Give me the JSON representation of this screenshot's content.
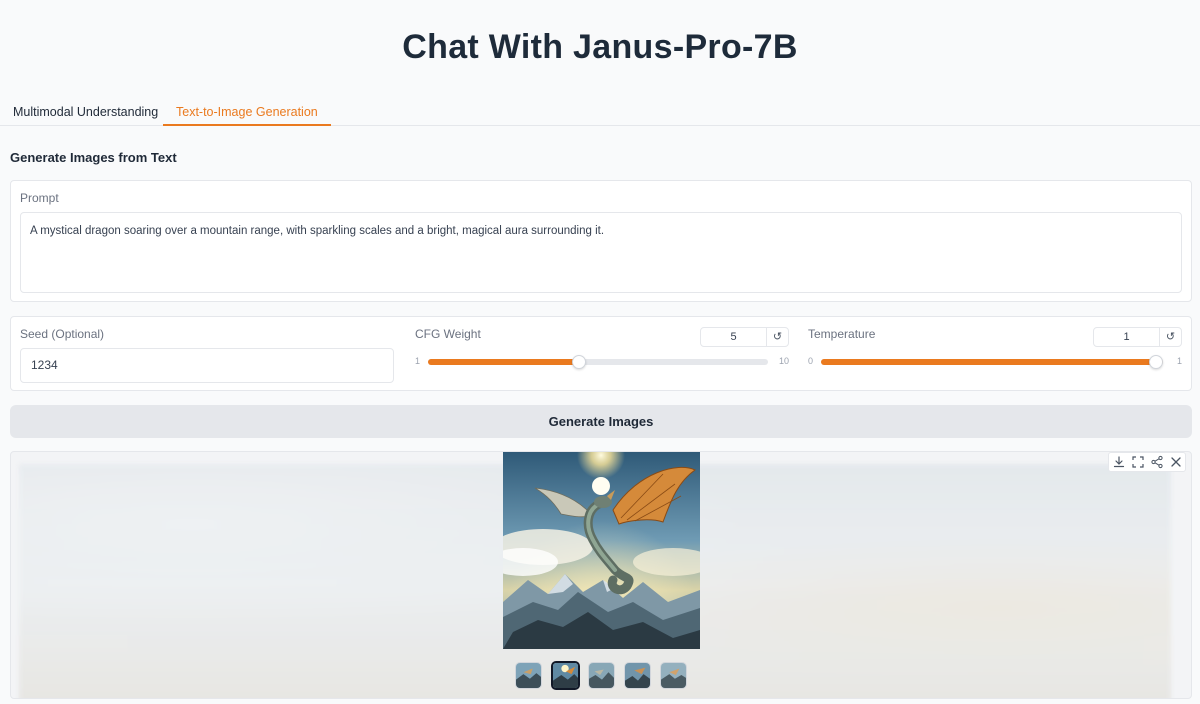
{
  "app": {
    "title": "Chat With Janus-Pro-7B"
  },
  "tabs": [
    {
      "label": "Multimodal Understanding",
      "active": false
    },
    {
      "label": "Text-to-Image Generation",
      "active": true
    }
  ],
  "section": {
    "title": "Generate Images from Text"
  },
  "prompt": {
    "label": "Prompt",
    "value": "A mystical dragon soaring over a mountain range, with sparkling scales and a bright, magical aura surrounding it."
  },
  "seed": {
    "label": "Seed (Optional)",
    "value": "1234"
  },
  "cfg": {
    "label": "CFG Weight",
    "value": "5",
    "min": "1",
    "max": "10",
    "level": 0.4444
  },
  "temperature": {
    "label": "Temperature",
    "value": "1",
    "min": "0",
    "max": "1",
    "level": 1.0
  },
  "generate_button": {
    "label": "Generate Images"
  },
  "gallery": {
    "thumbnail_count": 5,
    "selected_index": 1,
    "toolbar_icons": [
      "download-icon",
      "fullscreen-icon",
      "share-icon",
      "close-icon"
    ]
  },
  "colors": {
    "accent": "#ea7a1f",
    "title": "#1e2b3a",
    "button_bg": "#e5e7eb"
  }
}
